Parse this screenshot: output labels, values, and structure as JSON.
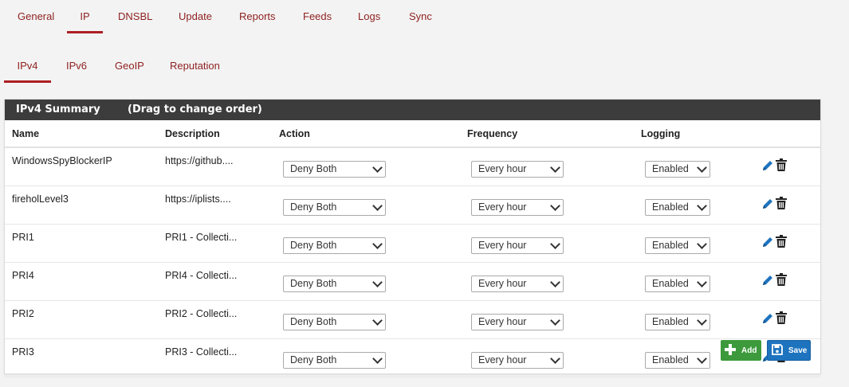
{
  "top_tabs": [
    {
      "label": "General",
      "active": false
    },
    {
      "label": "IP",
      "active": true
    },
    {
      "label": "DNSBL",
      "active": false
    },
    {
      "label": "Update",
      "active": false
    },
    {
      "label": "Reports",
      "active": false
    },
    {
      "label": "Feeds",
      "active": false
    },
    {
      "label": "Logs",
      "active": false
    },
    {
      "label": "Sync",
      "active": false
    }
  ],
  "sub_tabs": [
    {
      "label": "IPv4",
      "active": true
    },
    {
      "label": "IPv6",
      "active": false
    },
    {
      "label": "GeoIP",
      "active": false
    },
    {
      "label": "Reputation",
      "active": false
    }
  ],
  "panel": {
    "title": "IPv4 Summary",
    "hint": "(Drag to change order)"
  },
  "table": {
    "headers": {
      "name": "Name",
      "description": "Description",
      "action": "Action",
      "frequency": "Frequency",
      "logging": "Logging"
    },
    "rows": [
      {
        "name": "WindowsSpyBlockerIP",
        "description": "https://github....",
        "action": "Deny Both",
        "frequency": "Every hour",
        "logging": "Enabled"
      },
      {
        "name": "fireholLevel3",
        "description": "https://iplists....",
        "action": "Deny Both",
        "frequency": "Every hour",
        "logging": "Enabled"
      },
      {
        "name": "PRI1",
        "description": "PRI1 - Collecti...",
        "action": "Deny Both",
        "frequency": "Every hour",
        "logging": "Enabled"
      },
      {
        "name": "PRI4",
        "description": "PRI4 - Collecti...",
        "action": "Deny Both",
        "frequency": "Every hour",
        "logging": "Enabled"
      },
      {
        "name": "PRI2",
        "description": "PRI2 - Collecti...",
        "action": "Deny Both",
        "frequency": "Every hour",
        "logging": "Enabled"
      },
      {
        "name": "PRI3",
        "description": "PRI3 - Collecti...",
        "action": "Deny Both",
        "frequency": "Every hour",
        "logging": "Enabled"
      }
    ]
  },
  "buttons": {
    "add": "Add",
    "save": "Save"
  },
  "icons": {
    "edit": "pencil-icon",
    "delete": "trash-icon",
    "add": "plus-icon",
    "save": "floppy-disk-icon"
  },
  "colors": {
    "tab_text": "#8e1f1f",
    "tab_active_underline": "#ac1e23",
    "panel_header": "#3c3c3c",
    "add_button": "#3c9a3c",
    "save_button": "#1e73be",
    "edit_icon": "#1e73be"
  }
}
